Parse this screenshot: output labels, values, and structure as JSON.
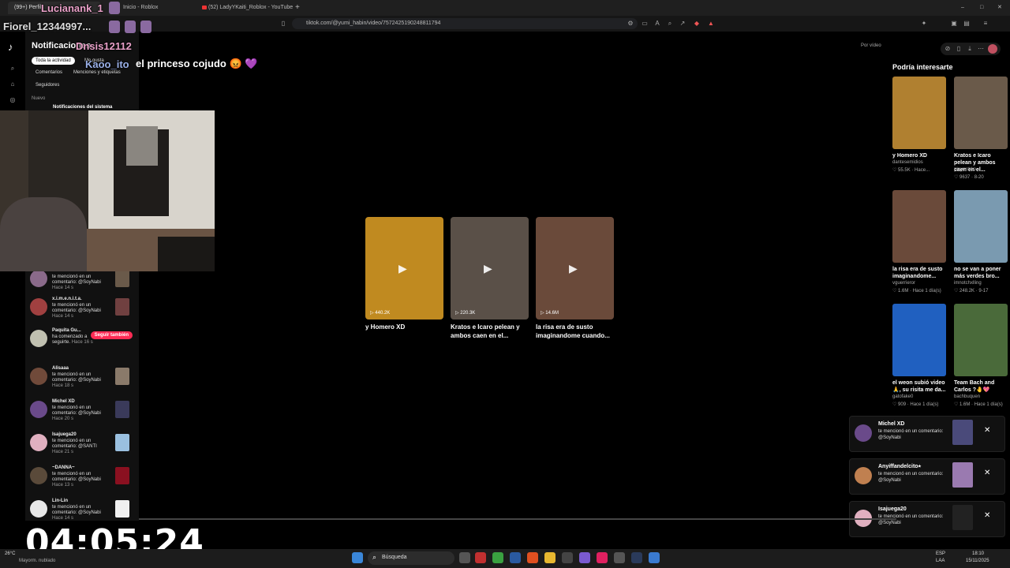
{
  "browser": {
    "tabs": [
      {
        "label": "(99+) Perfil",
        "active": true
      },
      {
        "label": "Inicio - Roblox",
        "active": false
      },
      {
        "label": "(52) LadyYKaiti_Roblox - YouTube",
        "active": false
      }
    ],
    "new_tab": "+",
    "url": "tiktok.com/@yumi_habin/video/7572425190248811794",
    "window_controls": [
      "–",
      "□",
      "✕"
    ]
  },
  "overlay_names": {
    "name1": "Lucianank_1",
    "name2": "Fiorel_12344997...",
    "name3": "Dnsis12112",
    "name4": "Kaoo_ito"
  },
  "notifications": {
    "title": "Notificaciones",
    "filters": [
      "Toda la actividad",
      "Me gusta",
      "Comentarios",
      "Menciones y etiquetas",
      "Seguidores"
    ],
    "section_new": "Nuevo",
    "system": "Notificaciones del sistema",
    "items": [
      {
        "name": "",
        "text": "te mencionó en un comentario: @SoyNabi",
        "time": "Hace 14 s",
        "avatar": "#8a6a8a",
        "thumb": "#6a5a4a"
      },
      {
        "name": "x.i.m.e.n.i.t.a.",
        "text": "te mencionó en un comentario: @SoyNabi",
        "time": "Hace 14 s",
        "avatar": "#a04040",
        "thumb": "#704040"
      },
      {
        "name": "Paquita Gu...",
        "text": "ha comenzado a seguirte.",
        "time": "Hace 16 s",
        "avatar": "#c0c0b0",
        "thumb": ""
      },
      {
        "name": "Alisaaa",
        "text": "te mencionó en un comentario: @SoyNabi",
        "time": "Hace 18 s",
        "avatar": "#704a3a",
        "thumb": "#8a7a6a"
      },
      {
        "name": "Michel XD",
        "text": "te mencionó en un comentario: @SoyNabi",
        "time": "Hace 20 s",
        "avatar": "#6a4a8a",
        "thumb": "#3a3a5a"
      },
      {
        "name": "Isajuega20",
        "text": "te mencionó en un comentario: @SANTI",
        "time": "Hace 21 s",
        "avatar": "#e0b0c0",
        "thumb": "#9ac0e0"
      },
      {
        "name": "~DANNA~",
        "text": "te mencionó en un comentario: @SoyNabi",
        "time": "Hace 13 s",
        "avatar": "#5a4a3a",
        "thumb": "#8a1020"
      },
      {
        "name": "Lin-Lin",
        "text": "te mencionó en un comentario: @SoyNabi",
        "time": "Hace 14 s",
        "avatar": "#e8e8e8",
        "thumb": "#f0f0f0"
      }
    ],
    "follow_back": "Seguir también"
  },
  "video_page": {
    "title": "el princeso cojudo",
    "emoji": "😡 💜",
    "top_right": "Por vídeo",
    "cards": [
      {
        "title": "y Homero XD",
        "views": "440.2K",
        "color": "#c08a20"
      },
      {
        "title": "Kratos e Icaro pelean y ambos caen en el...",
        "views": "220.3K",
        "color": "#5a5048"
      },
      {
        "title": "la risa era de susto imaginandome cuando...",
        "views": "14.6M",
        "color": "#6a4a3a"
      }
    ]
  },
  "suggested": {
    "title": "Podría interesarte",
    "items": [
      {
        "title": "y Homero XD",
        "author": "dantesemidios",
        "meta": "♡ 55.5K · Hace...",
        "color": "#b08030"
      },
      {
        "title": "Kratos e Icaro pelean y ambos caen en el...",
        "author": "playerdrko",
        "meta": "♡ 9637 · 8-20",
        "color": "#6a5a4a"
      },
      {
        "title": "la risa era de susto imaginandome...",
        "author": "vguerrieror",
        "meta": "♡ 1.6M · Hace 1 día(s)",
        "color": "#6a4a3a"
      },
      {
        "title": "no se van a poner más verdes bro...",
        "author": "imnotchxlling",
        "meta": "♡ 248.2K · 9-17",
        "color": "#7a9ab0"
      },
      {
        "title": "el weon subió video 🙏, su risita me da...",
        "author": "gatofake0",
        "meta": "♡ 909 · Hace 1 día(s)",
        "color": "#2060c0"
      },
      {
        "title": "Team Bach and Carlos ?🤚💖",
        "author": "bachbuquen",
        "meta": "♡ 1.6M · Hace 1 día(s)",
        "color": "#4a6a3a"
      }
    ]
  },
  "toasts": [
    {
      "name": "Michel XD",
      "msg": "te mencionó en un comentario: @SoyNabi",
      "avatar": "#6a4a8a",
      "thumb": "#4a4a7a"
    },
    {
      "name": "Anyiffandelcito⭑",
      "msg": "te mencionó en un comentario: @SoyNabi",
      "avatar": "#c08050",
      "thumb": "#9a7ab0"
    },
    {
      "name": "Isajuega20",
      "msg": "te mencionó en un comentario: @SoyNabi",
      "avatar": "#e0b0c0",
      "thumb": "#222"
    }
  ],
  "timer": "04:05:24",
  "taskbar": {
    "weather": "26°C",
    "weather_desc": "Mayorm. nublado",
    "search": "Búsqueda",
    "lang": "ESP",
    "lang2": "LAA",
    "time": "18:10",
    "date": "15/11/2025"
  }
}
